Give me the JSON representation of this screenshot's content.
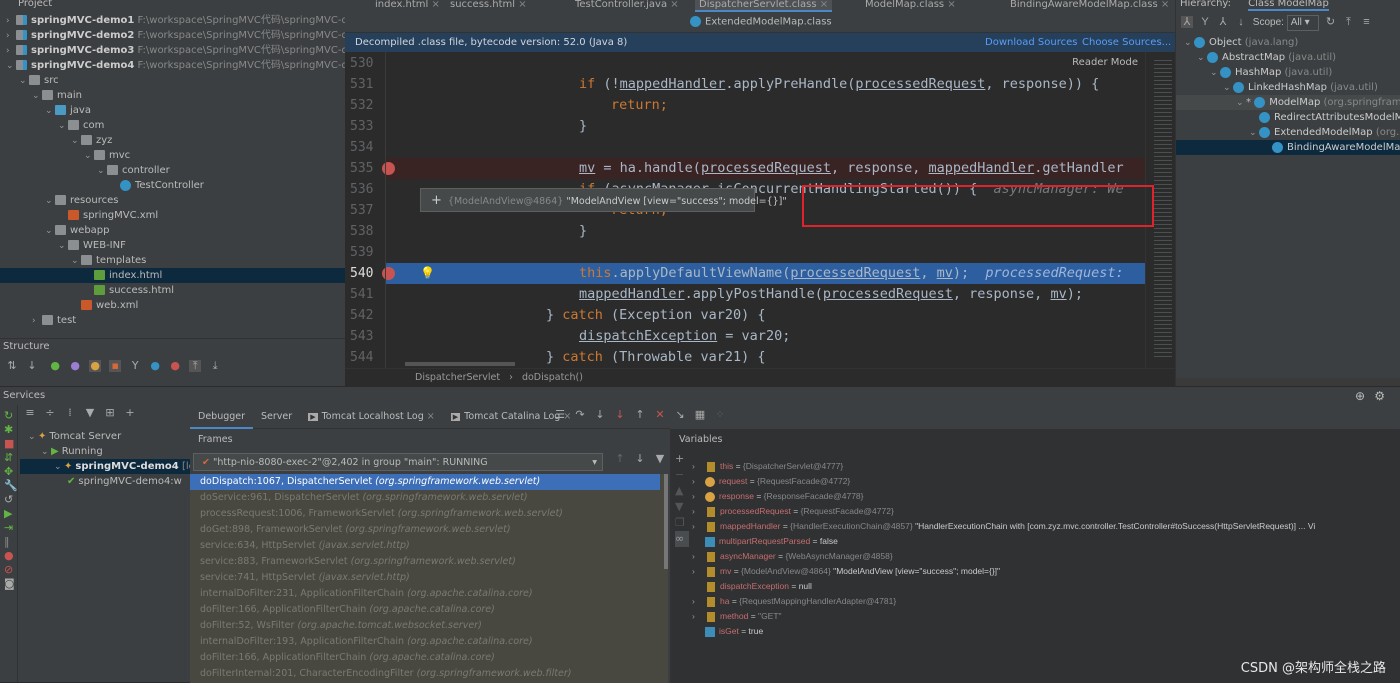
{
  "project": {
    "title": "Project",
    "items": [
      {
        "label": "springMVC-demo1",
        "path": "F:\\workspace\\SpringMVC代码\\springMVC-demo1",
        "depth": 0,
        "open": false,
        "bold": true
      },
      {
        "label": "springMVC-demo2",
        "path": "F:\\workspace\\SpringMVC代码\\springMVC-demo2",
        "depth": 0,
        "open": false,
        "bold": true
      },
      {
        "label": "springMVC-demo3",
        "path": "F:\\workspace\\SpringMVC代码\\springMVC-demo3",
        "depth": 0,
        "open": false,
        "bold": true
      },
      {
        "label": "springMVC-demo4",
        "path": "F:\\workspace\\SpringMVC代码\\springMVC-demo4",
        "depth": 0,
        "open": true,
        "bold": true
      },
      {
        "label": "src",
        "depth": 1,
        "open": true
      },
      {
        "label": "main",
        "depth": 2,
        "open": true
      },
      {
        "label": "java",
        "depth": 3,
        "open": true
      },
      {
        "label": "com",
        "depth": 4,
        "open": true
      },
      {
        "label": "zyz",
        "depth": 5,
        "open": true
      },
      {
        "label": "mvc",
        "depth": 6,
        "open": true
      },
      {
        "label": "controller",
        "depth": 7,
        "open": true
      },
      {
        "label": "TestController",
        "depth": 8,
        "type": "class"
      },
      {
        "label": "resources",
        "depth": 3,
        "open": true
      },
      {
        "label": "springMVC.xml",
        "depth": 4,
        "type": "xml"
      },
      {
        "label": "webapp",
        "depth": 3,
        "open": true
      },
      {
        "label": "WEB-INF",
        "depth": 4,
        "open": true
      },
      {
        "label": "templates",
        "depth": 5,
        "open": true
      },
      {
        "label": "index.html",
        "depth": 6,
        "type": "html",
        "selected": true
      },
      {
        "label": "success.html",
        "depth": 6,
        "type": "html"
      },
      {
        "label": "web.xml",
        "depth": 5,
        "type": "xml"
      },
      {
        "label": "test",
        "depth": 2,
        "open": false
      }
    ]
  },
  "structure": {
    "title": "Structure"
  },
  "editor": {
    "tabs": [
      "index.html",
      "success.html",
      "TestController.java",
      "DispatcherServlet.class",
      "ModelMap.class",
      "BindingAwareModelMap.class"
    ],
    "active_tab": "DispatcherServlet.class",
    "second_row_tab": "ExtendedModelMap.class",
    "banner": "Decompiled .class file, bytecode version: 52.0 (Java 8)",
    "download_sources": "Download Sources",
    "choose_sources": "Choose Sources...",
    "reader_mode": "Reader Mode",
    "lines": [
      {
        "n": "530",
        "html": ""
      },
      {
        "n": "531",
        "html": "            <span class='kw'>if</span> (!<span class='ul'>mappedHandler</span>.applyPreHandle(<span class='ul'>processedRequest</span>, response)) {"
      },
      {
        "n": "532",
        "html": "                <span class='kw'>return;</span>"
      },
      {
        "n": "533",
        "html": "            }"
      },
      {
        "n": "534",
        "html": ""
      },
      {
        "n": "535",
        "html": "            <span class='ul'>mv</span> = ha.handle(<span class='ul'>processedRequest</span>, response, <span class='ul'>mappedHandler</span>.getHandler",
        "bp": true,
        "bg": "#3a2323"
      },
      {
        "n": "536",
        "html": "            <span class='kw'>if</span> (asyncManager.isConcurrentHandlingStarted()) {  <i style='color:#787878'>asyncManager: We</i>"
      },
      {
        "n": "537",
        "html": "                <span class='kw'>return;</span>"
      },
      {
        "n": "538",
        "html": "            }"
      },
      {
        "n": "539",
        "html": ""
      },
      {
        "n": "540",
        "html": "            <span class='kw'>this</span>.applyDefaultViewName(<span class='ul'>processedRequest</span>, <span class='ul'>mv</span>);  <i style='color:#9fb4d9'>processedRequest:</i>",
        "bp": true,
        "bg": "#2d5fa0",
        "bulb": true
      },
      {
        "n": "541",
        "html": "            <span class='ul'>mappedHandler</span>.applyPostHandle(<span class='ul'>processedRequest</span>, response, <span class='ul'>mv</span>);"
      },
      {
        "n": "542",
        "html": "        } <span class='kw'>catch</span> (Exception var20) {"
      },
      {
        "n": "543",
        "html": "            <span class='ul'>dispatchException</span> = var20;"
      },
      {
        "n": "544",
        "html": "        } <span class='kw'>catch</span> (Throwable var21) {"
      }
    ],
    "tooltip": {
      "ref": "{ModelAndView@4864}",
      "value": "\"ModelAndView [view=\"success\"; model={}]\""
    },
    "breadcrumb": [
      "DispatcherServlet",
      "doDispatch()"
    ]
  },
  "hierarchy": {
    "title": "Hierarchy:",
    "tab": "Class ModelMap",
    "scope_label": "Scope:",
    "scope_value": "All",
    "items": [
      {
        "name": "Object",
        "pkg": "(java.lang)",
        "depth": 0
      },
      {
        "name": "AbstractMap",
        "pkg": "(java.util)",
        "depth": 1
      },
      {
        "name": "HashMap",
        "pkg": "(java.util)",
        "depth": 2
      },
      {
        "name": "LinkedHashMap",
        "pkg": "(java.util)",
        "depth": 3
      },
      {
        "name": "ModelMap",
        "pkg": "(org.springfram",
        "depth": 4,
        "star": true
      },
      {
        "name": "RedirectAttributesModelM",
        "pkg": "",
        "depth": 5
      },
      {
        "name": "ExtendedModelMap",
        "pkg": "(org.",
        "depth": 5
      },
      {
        "name": "BindingAwareModelMa",
        "pkg": "",
        "depth": 6,
        "selected": true
      }
    ]
  },
  "services": {
    "title": "Services",
    "tree": [
      {
        "label": "Tomcat Server",
        "depth": 0
      },
      {
        "label": "Running",
        "depth": 1
      },
      {
        "label": "springMVC-demo4",
        "suffix": "[local]",
        "depth": 2,
        "selected": true
      },
      {
        "label": "springMVC-demo4:w",
        "depth": 3
      }
    ],
    "tabs": [
      "Debugger",
      "Server",
      "Tomcat Localhost Log",
      "Tomcat Catalina Log"
    ],
    "frames_title": "Frames",
    "thread": "\"http-nio-8080-exec-2\"@2,402 in group \"main\": RUNNING",
    "frames": [
      {
        "m": "doDispatch:1067, DispatcherServlet",
        "p": "(org.springframework.web.servlet)",
        "selected": true
      },
      {
        "m": "doService:961, DispatcherServlet",
        "p": "(org.springframework.web.servlet)"
      },
      {
        "m": "processRequest:1006, FrameworkServlet",
        "p": "(org.springframework.web.servlet)"
      },
      {
        "m": "doGet:898, FrameworkServlet",
        "p": "(org.springframework.web.servlet)"
      },
      {
        "m": "service:634, HttpServlet",
        "p": "(javax.servlet.http)"
      },
      {
        "m": "service:883, FrameworkServlet",
        "p": "(org.springframework.web.servlet)"
      },
      {
        "m": "service:741, HttpServlet",
        "p": "(javax.servlet.http)"
      },
      {
        "m": "internalDoFilter:231, ApplicationFilterChain",
        "p": "(org.apache.catalina.core)"
      },
      {
        "m": "doFilter:166, ApplicationFilterChain",
        "p": "(org.apache.catalina.core)"
      },
      {
        "m": "doFilter:52, WsFilter",
        "p": "(org.apache.tomcat.websocket.server)"
      },
      {
        "m": "internalDoFilter:193, ApplicationFilterChain",
        "p": "(org.apache.catalina.core)"
      },
      {
        "m": "doFilter:166, ApplicationFilterChain",
        "p": "(org.apache.catalina.core)"
      },
      {
        "m": "doFilterInternal:201, CharacterEncodingFilter",
        "p": "(org.springframework.web.filter)"
      }
    ],
    "variables_title": "Variables",
    "variables": [
      {
        "name": "this",
        "ref": "{DispatcherServlet@4777}",
        "val": "",
        "icon": "field",
        "exp": true
      },
      {
        "name": "request",
        "ref": "{RequestFacade@4772}",
        "val": "",
        "icon": "param",
        "exp": true
      },
      {
        "name": "response",
        "ref": "{ResponseFacade@4778}",
        "val": "",
        "icon": "param",
        "exp": true
      },
      {
        "name": "processedRequest",
        "ref": "{RequestFacade@4772}",
        "val": "",
        "icon": "field",
        "exp": true
      },
      {
        "name": "mappedHandler",
        "ref": "{HandlerExecutionChain@4857}",
        "val": "\"HandlerExecutionChain with [com.zyz.mvc.controller.TestController#toSuccess(HttpServletRequest)] ... Vi",
        "icon": "field",
        "exp": true
      },
      {
        "name": "multipartRequestParsed",
        "ref": "",
        "val": "false",
        "icon": "bool",
        "exp": false
      },
      {
        "name": "asyncManager",
        "ref": "{WebAsyncManager@4858}",
        "val": "",
        "icon": "field",
        "exp": true
      },
      {
        "name": "mv",
        "ref": "{ModelAndView@4864}",
        "val": "\"ModelAndView [view=\"success\"; model={}]\"",
        "icon": "field",
        "exp": true
      },
      {
        "name": "dispatchException",
        "ref": "",
        "val": "null",
        "icon": "field",
        "exp": false
      },
      {
        "name": "ha",
        "ref": "{RequestMappingHandlerAdapter@4781}",
        "val": "",
        "icon": "field",
        "exp": true
      },
      {
        "name": "method",
        "ref": "\"GET\"",
        "val": "",
        "icon": "field",
        "exp": true
      },
      {
        "name": "isGet",
        "ref": "",
        "val": "true",
        "icon": "bool",
        "exp": false
      }
    ]
  },
  "watermark": "CSDN @架构师全栈之路",
  "colors": {
    "accent": "#4a88c7",
    "selection": "#2d5fa0",
    "breakpoint": "#c75450",
    "highlight_box": "#e0232b"
  }
}
